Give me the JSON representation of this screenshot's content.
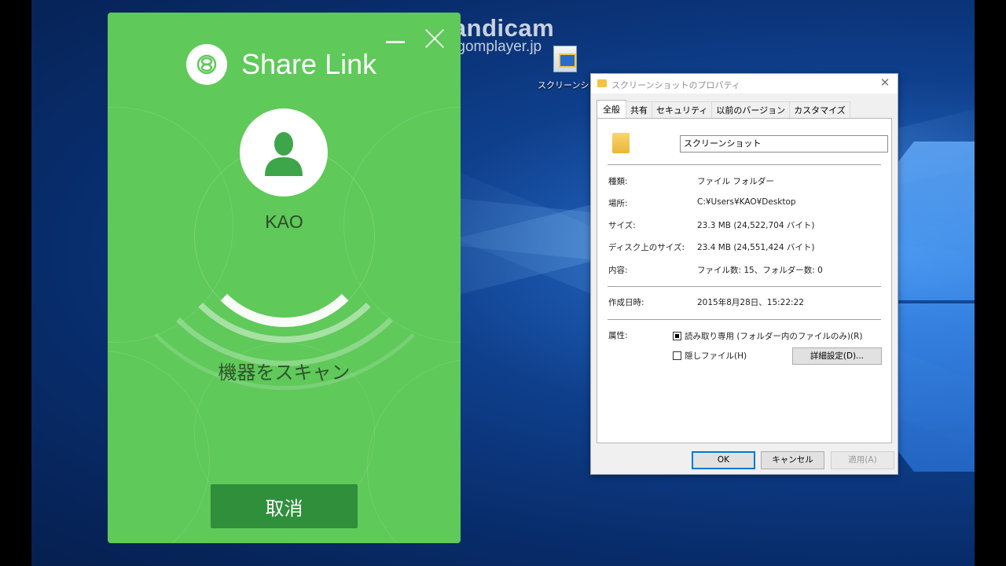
{
  "watermark": {
    "title": "Bandicam",
    "url": "www.gomplayer.jp"
  },
  "desktop_icon": {
    "label": "スクリーンショッ",
    "icon": "screenshot-folder-icon"
  },
  "share_link": {
    "app_name": "Share Link",
    "user_name": "KAO",
    "status_text": "機器をスキャン",
    "cancel_label": "取消",
    "colors": {
      "background": "#5fc95a",
      "button": "#2f8f3b"
    }
  },
  "properties_dialog": {
    "title": "スクリーンショットのプロパティ",
    "tabs": [
      "全般",
      "共有",
      "セキュリティ",
      "以前のバージョン",
      "カスタマイズ"
    ],
    "active_tab": "全般",
    "folder_name": "スクリーンショット",
    "rows": [
      {
        "label": "種類:",
        "value": "ファイル フォルダー"
      },
      {
        "label": "場所:",
        "value": "C:¥Users¥KAO¥Desktop"
      },
      {
        "label": "サイズ:",
        "value": "23.3 MB (24,522,704 バイト)"
      },
      {
        "label": "ディスク上のサイズ:",
        "value": "23.4 MB (24,551,424 バイト)"
      },
      {
        "label": "内容:",
        "value": "ファイル数: 15、フォルダー数: 0"
      }
    ],
    "created": {
      "label": "作成日時:",
      "value": "2015年8月28日、15:22:22"
    },
    "attributes": {
      "label": "属性:",
      "readonly_label": "読み取り専用 (フォルダー内のファイルのみ)(R)",
      "hidden_label": "隠しファイル(H)",
      "advanced_label": "詳細設定(D)..."
    },
    "buttons": {
      "ok": "OK",
      "cancel": "キャンセル",
      "apply": "適用(A)"
    }
  }
}
